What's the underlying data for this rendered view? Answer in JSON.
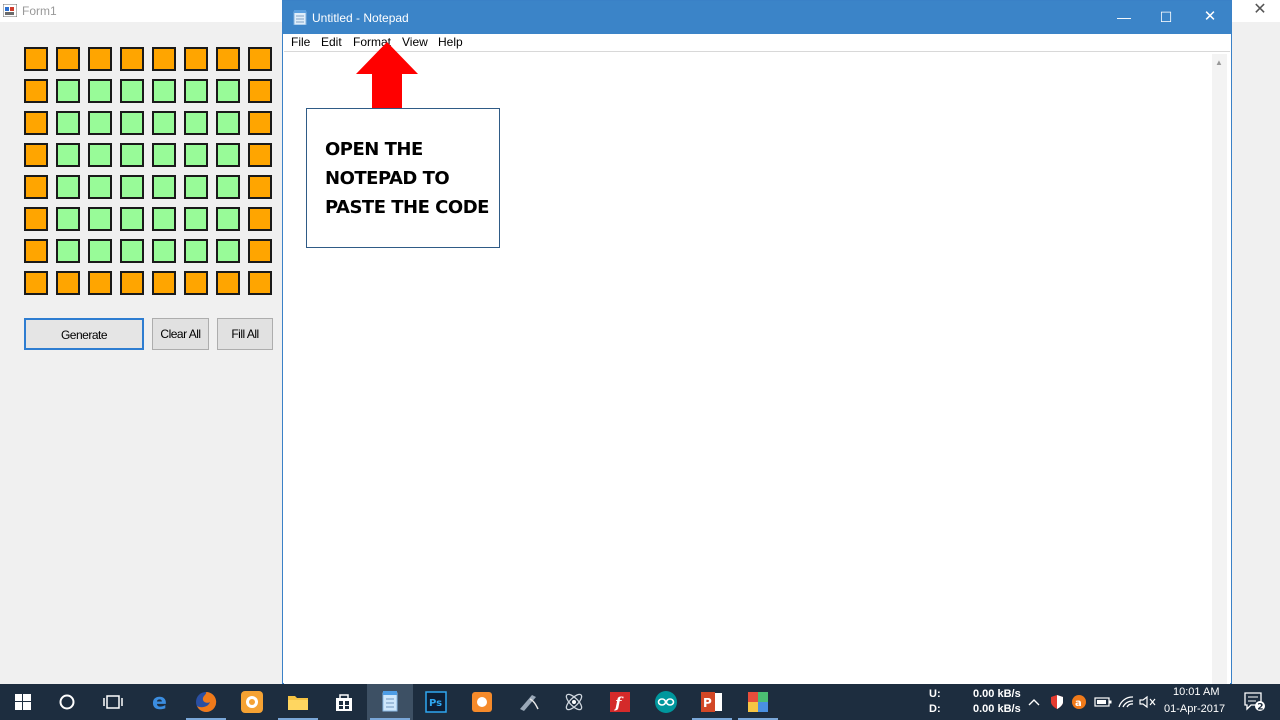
{
  "form1": {
    "title": "Form1",
    "close_glyph": "✕",
    "grid": {
      "rows": [
        [
          "orange",
          "orange",
          "orange",
          "orange",
          "orange",
          "orange",
          "orange",
          "orange"
        ],
        [
          "orange",
          "green",
          "green",
          "green",
          "green",
          "green",
          "green",
          "orange"
        ],
        [
          "orange",
          "green",
          "green",
          "green",
          "green",
          "green",
          "green",
          "orange"
        ],
        [
          "orange",
          "green",
          "green",
          "green",
          "green",
          "green",
          "green",
          "orange"
        ],
        [
          "orange",
          "green",
          "green",
          "green",
          "green",
          "green",
          "green",
          "orange"
        ],
        [
          "orange",
          "green",
          "green",
          "green",
          "green",
          "green",
          "green",
          "orange"
        ],
        [
          "orange",
          "green",
          "green",
          "green",
          "green",
          "green",
          "green",
          "orange"
        ],
        [
          "orange",
          "orange",
          "orange",
          "orange",
          "orange",
          "orange",
          "orange",
          "orange"
        ]
      ],
      "colors": {
        "orange": "#ffa500",
        "green": "#98fb98"
      }
    },
    "buttons": {
      "generate": "Generate",
      "clear_all": "Clear All",
      "fill_all": "Fill All"
    }
  },
  "notepad": {
    "title": "Untitled - Notepad",
    "controls": {
      "minimize": "—",
      "maximize": "☐",
      "close": "✕"
    },
    "menu": [
      "File",
      "Edit",
      "Format",
      "View",
      "Help"
    ]
  },
  "annotation": {
    "lines": [
      "OPEN THE",
      "NOTEPAD TO",
      "PASTE THE CODE"
    ],
    "arrow_color": "#ff0000"
  },
  "taskbar": {
    "icons": [
      "windows-start-icon",
      "cortana-search-icon",
      "task-view-icon",
      "edge-browser-icon",
      "firefox-icon",
      "uc-browser-icon",
      "file-explorer-icon",
      "store-icon",
      "notepad-icon",
      "photoshop-icon",
      "app-orange-icon",
      "app-pen-icon",
      "app-atom-icon",
      "flash-icon",
      "arduino-icon",
      "powerpoint-icon",
      "app-colorful-icon"
    ],
    "upload_label": "U:",
    "download_label": "D:",
    "upload_rate": "0.00 kB/s",
    "download_rate": "0.00 kB/s",
    "time": "10:01 AM",
    "date": "01-Apr-2017",
    "notification_count": "2"
  }
}
